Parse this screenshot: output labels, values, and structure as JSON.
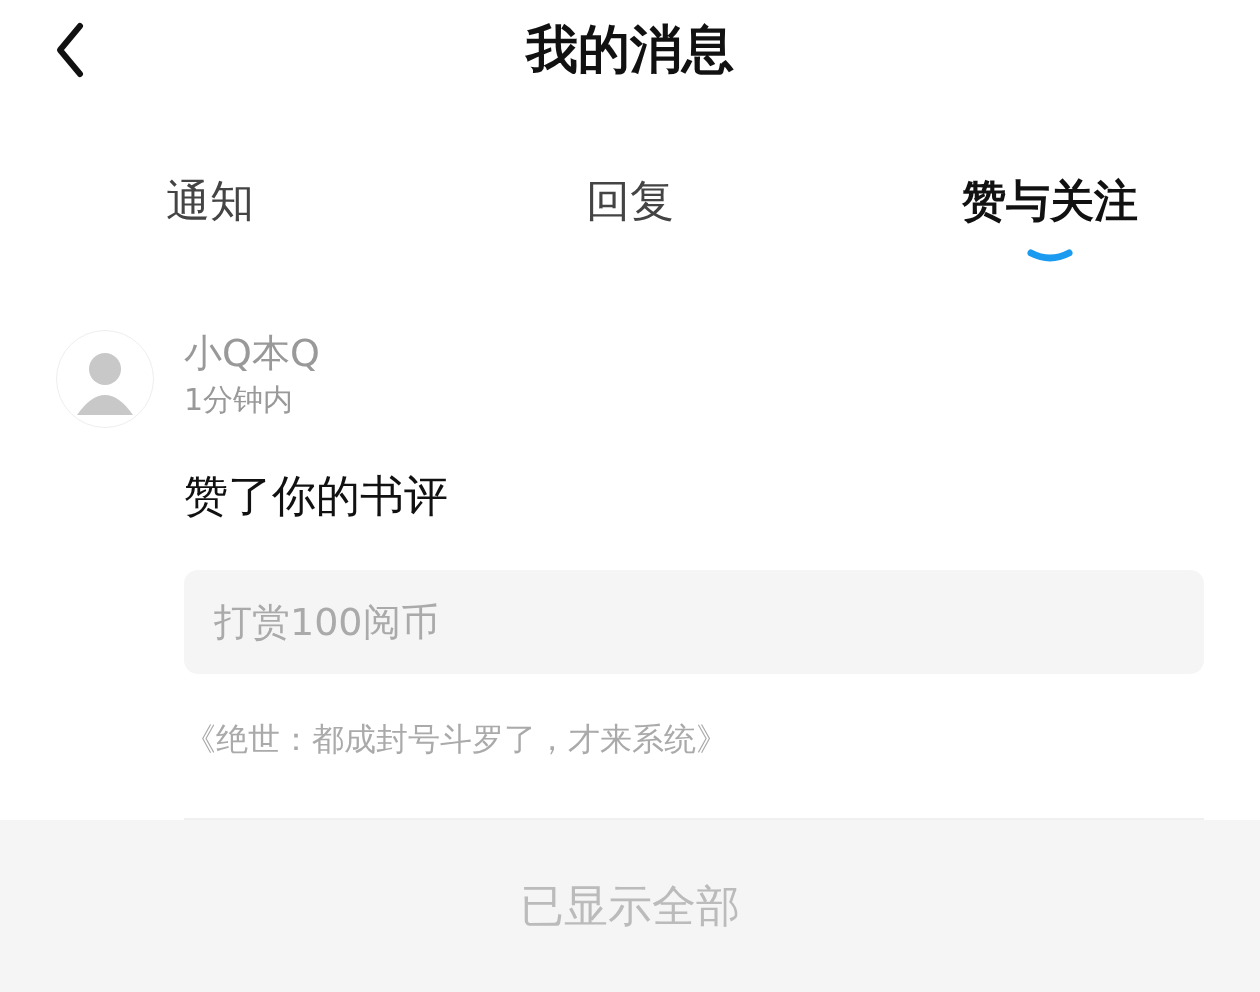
{
  "header": {
    "title": "我的消息"
  },
  "tabs": [
    {
      "label": "通知",
      "selected": false
    },
    {
      "label": "回复",
      "selected": false
    },
    {
      "label": "赞与关注",
      "selected": true
    }
  ],
  "messages": [
    {
      "user": "小Q本Q",
      "time": "1分钟内",
      "action": "赞了你的书评",
      "quote": "打赏100阅币",
      "book": "《绝世：都成封号斗罗了，才来系统》"
    }
  ],
  "footer": {
    "text": "已显示全部"
  }
}
